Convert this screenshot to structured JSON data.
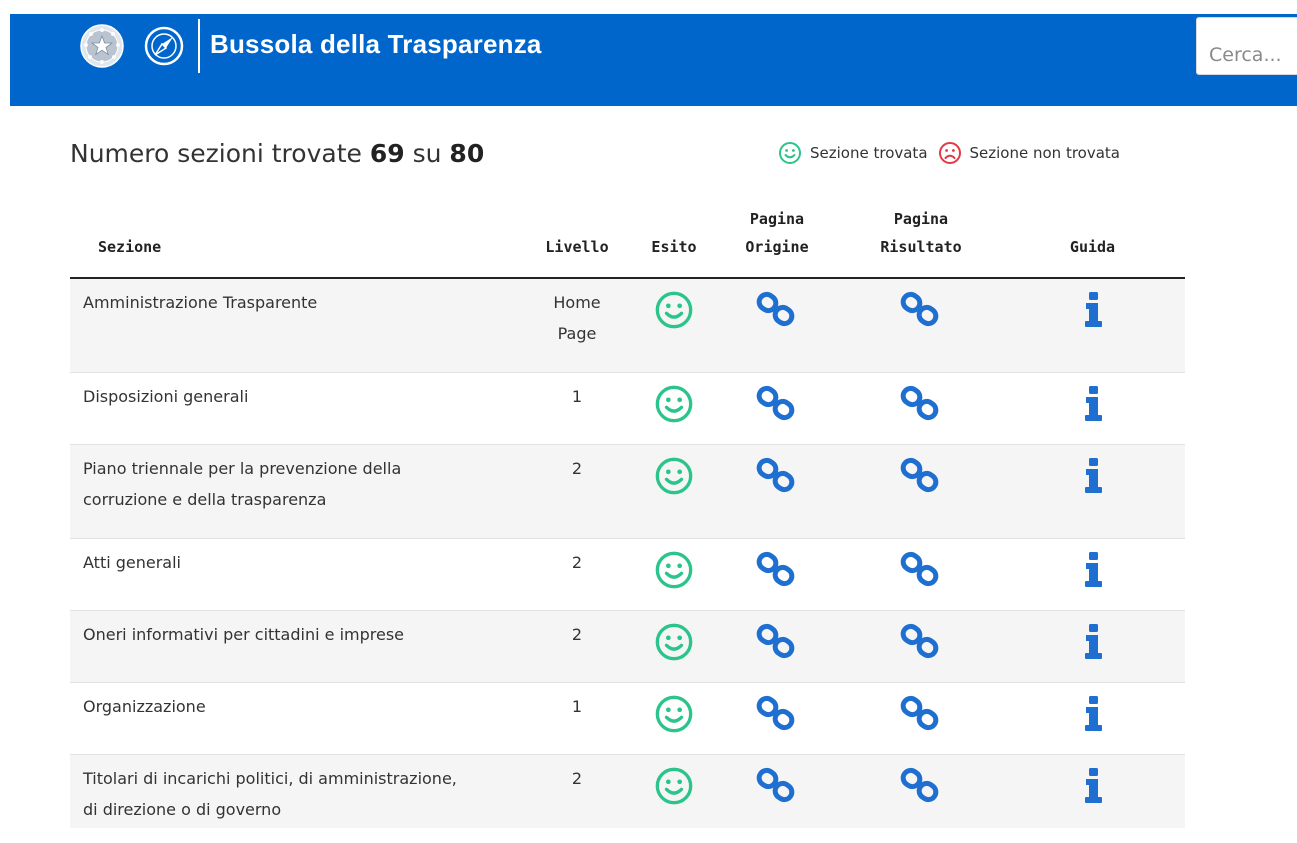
{
  "header": {
    "brand": "Bussola della Trasparenza",
    "search_placeholder": "Cerca..."
  },
  "summary": {
    "prefix": "Numero sezioni trovate",
    "found": "69",
    "middle": "su",
    "total": "80"
  },
  "legend": {
    "found_label": "Sezione trovata",
    "not_found_label": "Sezione non trovata"
  },
  "table": {
    "headers": {
      "sezione": "Sezione",
      "livello": "Livello",
      "esito": "Esito",
      "origine_1": "Pagina",
      "origine_2": "Origine",
      "risultato_1": "Pagina",
      "risultato_2": "Risultato",
      "guida": "Guida"
    },
    "rows": [
      {
        "sezione_1": "Amministrazione Trasparente",
        "sezione_2": "",
        "livello_1": "Home",
        "livello_2": "Page",
        "esito": "found"
      },
      {
        "sezione_1": "Disposizioni generali",
        "sezione_2": "",
        "livello_1": "1",
        "livello_2": "",
        "esito": "found"
      },
      {
        "sezione_1": "Piano triennale per la prevenzione della",
        "sezione_2": "corruzione e della trasparenza",
        "livello_1": "2",
        "livello_2": "",
        "esito": "found"
      },
      {
        "sezione_1": "Atti generali",
        "sezione_2": "",
        "livello_1": "2",
        "livello_2": "",
        "esito": "found"
      },
      {
        "sezione_1": "Oneri informativi per cittadini e imprese",
        "sezione_2": "",
        "livello_1": "2",
        "livello_2": "",
        "esito": "found"
      },
      {
        "sezione_1": "Organizzazione",
        "sezione_2": "",
        "livello_1": "1",
        "livello_2": "",
        "esito": "found"
      },
      {
        "sezione_1": "Titolari di incarichi politici, di amministrazione,",
        "sezione_2": "di direzione o di governo",
        "livello_1": "2",
        "livello_2": "",
        "esito": "found"
      }
    ]
  },
  "colors": {
    "header_bg": "#0066cc",
    "found": "#2bc48a",
    "not_found": "#e03a45",
    "link": "#1f6fd1"
  }
}
